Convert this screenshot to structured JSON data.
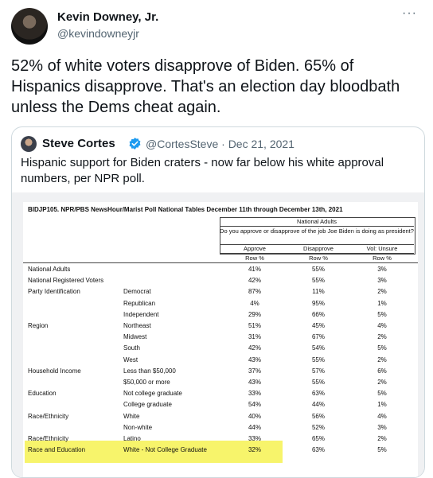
{
  "author": {
    "name": "Kevin Downey, Jr.",
    "handle": "@kevindowneyjr"
  },
  "more_label": "···",
  "tweet_text": "52% of white voters disapprove of Biden. 65% of Hispanics disapprove. That's an election day bloodbath unless the Dems cheat again.",
  "quote": {
    "name": "Steve Cortes",
    "handle_date": "@CortesSteve · Dec 21, 2021",
    "text": "Hispanic support for Biden craters - now far below his white approval numbers, per NPR poll."
  },
  "poll": {
    "title": "BIDJP105. NPR/PBS NewsHour/Marist Poll National Tables December 11th through December 13th, 2021",
    "group_header": "National Adults",
    "question": "Do you approve or disapprove of the job Joe Biden is doing as president?",
    "columns": [
      "Approve",
      "Disapprove",
      "Vol: Unsure"
    ],
    "subheader": "Row %",
    "rows": [
      {
        "cat": "National Adults",
        "sub": "",
        "a": "41%",
        "d": "55%",
        "u": "3%"
      },
      {
        "cat": "National Registered Voters",
        "sub": "",
        "a": "42%",
        "d": "55%",
        "u": "3%"
      },
      {
        "cat": "Party Identification",
        "sub": "Democrat",
        "a": "87%",
        "d": "11%",
        "u": "2%"
      },
      {
        "cat": "",
        "sub": "Republican",
        "a": "4%",
        "d": "95%",
        "u": "1%"
      },
      {
        "cat": "",
        "sub": "Independent",
        "a": "29%",
        "d": "66%",
        "u": "5%"
      },
      {
        "cat": "Region",
        "sub": "Northeast",
        "a": "51%",
        "d": "45%",
        "u": "4%"
      },
      {
        "cat": "",
        "sub": "Midwest",
        "a": "31%",
        "d": "67%",
        "u": "2%"
      },
      {
        "cat": "",
        "sub": "South",
        "a": "42%",
        "d": "54%",
        "u": "5%"
      },
      {
        "cat": "",
        "sub": "West",
        "a": "43%",
        "d": "55%",
        "u": "2%"
      },
      {
        "cat": "Household Income",
        "sub": "Less than $50,000",
        "a": "37%",
        "d": "57%",
        "u": "6%"
      },
      {
        "cat": "",
        "sub": "$50,000 or more",
        "a": "43%",
        "d": "55%",
        "u": "2%"
      },
      {
        "cat": "Education",
        "sub": "Not college graduate",
        "a": "33%",
        "d": "63%",
        "u": "5%"
      },
      {
        "cat": "",
        "sub": "College graduate",
        "a": "54%",
        "d": "44%",
        "u": "1%"
      },
      {
        "cat": "Race/Ethnicity",
        "sub": "White",
        "a": "40%",
        "d": "56%",
        "u": "4%"
      },
      {
        "cat": "",
        "sub": "Non-white",
        "a": "44%",
        "d": "52%",
        "u": "3%"
      },
      {
        "cat": "Race/Ethnicity",
        "sub": "Latino",
        "a": "33%",
        "d": "65%",
        "u": "2%"
      },
      {
        "cat": "Race and Education",
        "sub": "White - Not College Graduate",
        "a": "32%",
        "d": "63%",
        "u": "5%"
      }
    ]
  },
  "colors": {
    "highlight": "#f7f46b",
    "verified": "#1d9bf0",
    "secondary_text": "#536471"
  }
}
